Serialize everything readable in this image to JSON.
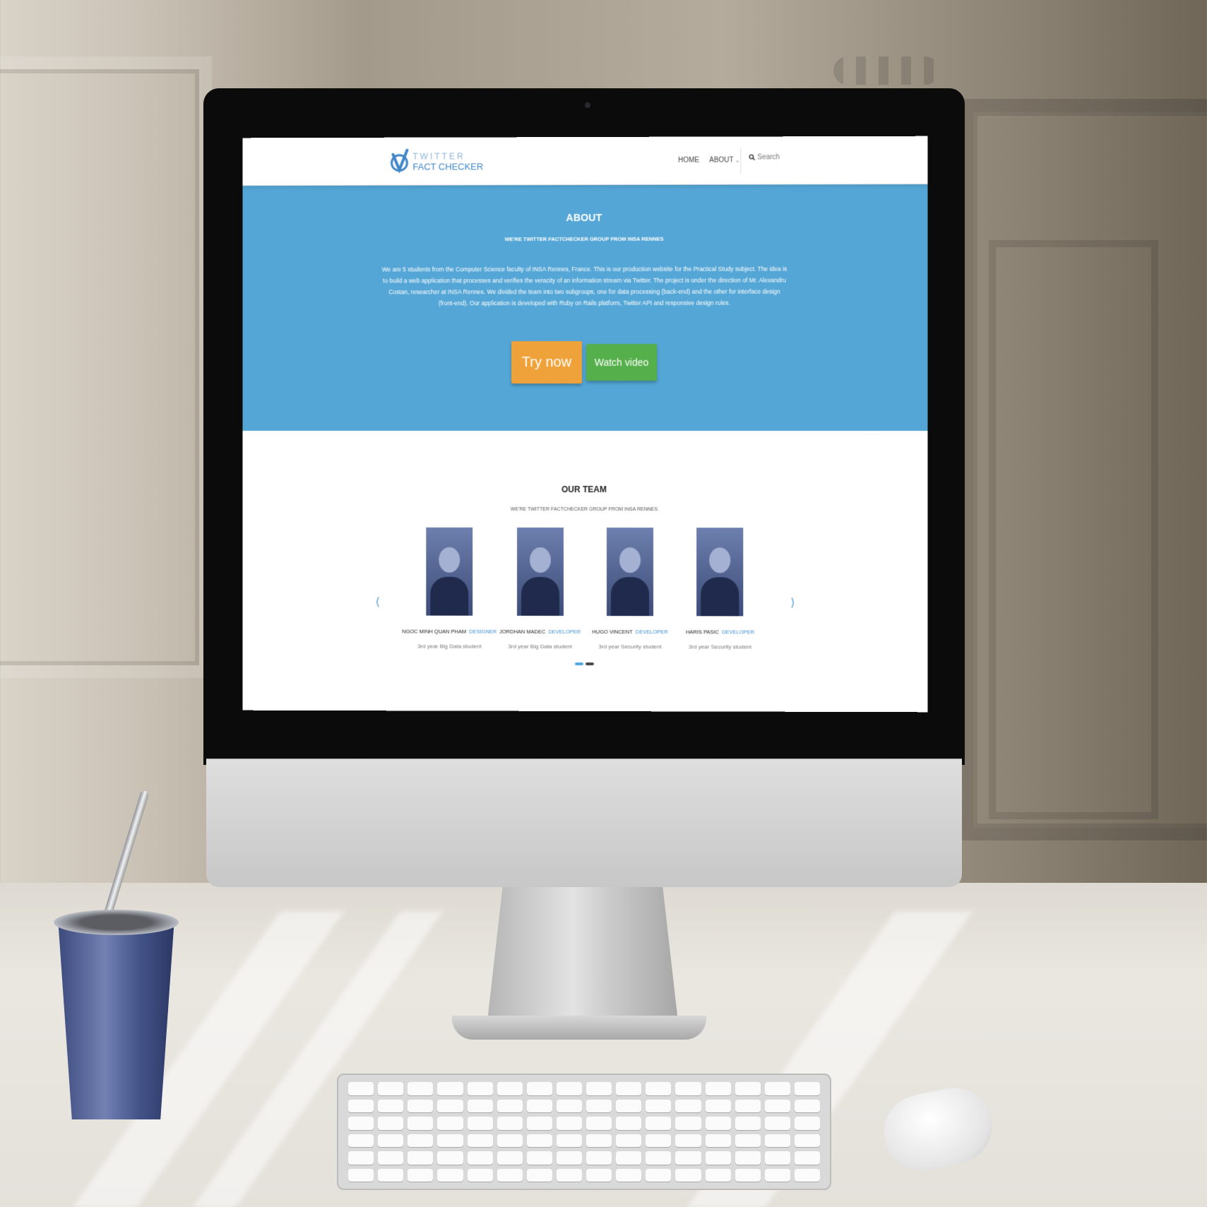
{
  "site": {
    "logo": {
      "line1": "TWITTER",
      "line2": "FACT CHECKER",
      "accent": "#3f86c6"
    },
    "nav": {
      "home": "HOME",
      "about": "ABOUT",
      "about_icon": "chevron-down-icon",
      "search_icon": "search-icon",
      "search_placeholder": "Search"
    },
    "hero": {
      "title": "ABOUT",
      "subtitle": "WE'RE TWITTER FACTCHECKER GROUP FROM INSA RENNES",
      "body": "We are 5 students from the Computer Science faculty of INSA Rennes, France. This is our production website for the Practical Study subject. The idea is to build a web application that processes and verifies the veracity of an information stream via Twitter. The project is under the direction of Mr. Alexandru Costan, researcher at INSA Rennes. We divided the team into two subgroups, one for data processing (back-end) and the other for interface design (front-end). Our application is developed with Ruby on Rails platform, Twitter API and responsive design rules.",
      "try_label": "Try now",
      "watch_label": "Watch video",
      "background": "#54a6d6",
      "try_color": "#f0a23a",
      "watch_color": "#55b04b"
    },
    "team": {
      "title": "OUR TEAM",
      "subtitle": "WE'RE TWITTER FACTCHECKER GROUP FROM INSA RENNES",
      "prev_icon": "chevron-left-icon",
      "next_icon": "chevron-right-icon",
      "members": [
        {
          "name": "NGOC MINH QUAN PHAM",
          "role": "DESIGNER",
          "desc": "3rd year Big Data student"
        },
        {
          "name": "JORDHAN MADEC",
          "role": "DEVELOPER",
          "desc": "3rd year Big Data student"
        },
        {
          "name": "HUGO VINCENT",
          "role": "DEVELOPER",
          "desc": "3rd year Security student"
        },
        {
          "name": "HARIS PASIC",
          "role": "DEVELOPER",
          "desc": "3rd year Security student"
        }
      ],
      "slides_total": 2,
      "slide_active": 1
    }
  }
}
